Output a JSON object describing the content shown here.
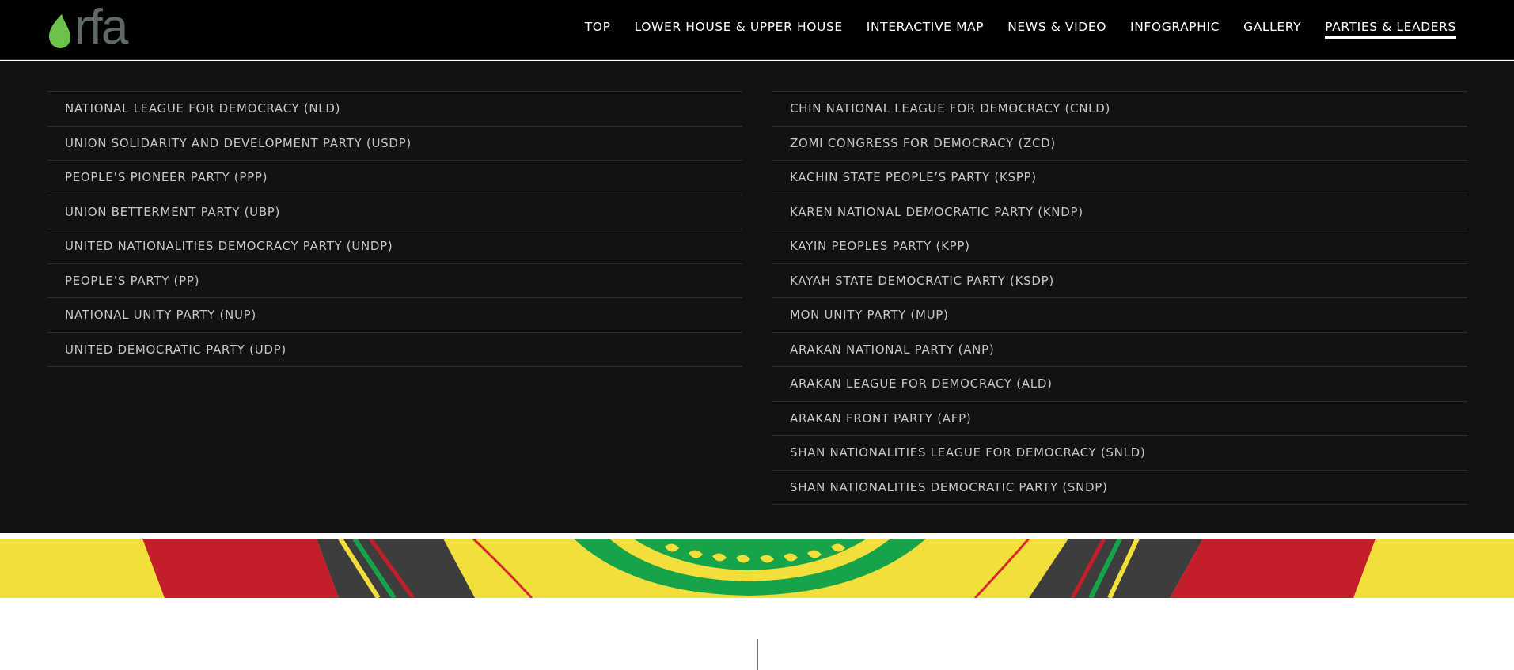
{
  "header": {
    "logo": {
      "text": "rfa",
      "icon": "rfa-drop-icon",
      "accent": "#6cc24a"
    },
    "nav": [
      {
        "label": "TOP"
      },
      {
        "label": "LOWER HOUSE & UPPER HOUSE"
      },
      {
        "label": "INTERACTIVE MAP"
      },
      {
        "label": "NEWS & VIDEO"
      },
      {
        "label": "INFOGRAPHIC"
      },
      {
        "label": "GALLERY"
      },
      {
        "label": "PARTIES & LEADERS",
        "active": true
      }
    ]
  },
  "menu": {
    "left": [
      "NATIONAL LEAGUE FOR DEMOCRACY (NLD)",
      "UNION SOLIDARITY AND DEVELOPMENT PARTY (USDP)",
      "PEOPLE’S PIONEER PARTY (PPP)",
      "UNION BETTERMENT PARTY (UBP)",
      "UNITED NATIONALITIES DEMOCRACY PARTY (UNDP)",
      "PEOPLE’S PARTY (PP)",
      "NATIONAL UNITY PARTY (NUP)",
      "UNITED DEMOCRATIC PARTY (UDP)"
    ],
    "right": [
      "CHIN NATIONAL LEAGUE FOR DEMOCRACY (CNLD)",
      "ZOMI CONGRESS FOR DEMOCRACY (ZCD)",
      "KACHIN STATE PEOPLE’S PARTY (KSPP)",
      "KAREN NATIONAL DEMOCRATIC PARTY (KNDP)",
      "KAYIN PEOPLES PARTY (KPP)",
      "KAYAH STATE DEMOCRATIC PARTY (KSDP)",
      "MON UNITY PARTY (MUP)",
      "ARAKAN NATIONAL PARTY (ANP)",
      "ARAKAN LEAGUE FOR DEMOCRACY (ALD)",
      "ARAKAN FRONT PARTY (AFP)",
      "SHAN NATIONALITIES LEAGUE FOR DEMOCRACY (SNLD)",
      "SHAN NATIONALITIES DEMOCRATIC PARTY (SNDP)"
    ]
  },
  "colors": {
    "header_bg": "#000000",
    "panel_bg": "#121212",
    "menu_text": "#c7c7c7",
    "banner_yellow": "#f2df3c",
    "banner_red": "#c41e2a",
    "banner_green": "#17a34a",
    "banner_dark": "#3d3d3d"
  }
}
